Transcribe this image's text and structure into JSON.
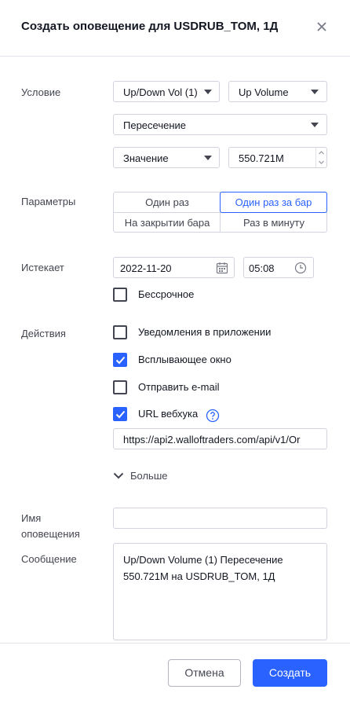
{
  "title": "Создать оповещение для USDRUB_TOM, 1Д",
  "condition": {
    "label": "Условие",
    "source": "Up/Down Vol (1)",
    "series": "Up Volume",
    "operator": "Пересечение",
    "target_type": "Значение",
    "value": "550.721M"
  },
  "parameters": {
    "label": "Параметры",
    "options": [
      "Один раз",
      "Один раз за бар",
      "На закрытии бара",
      "Раз в минуту"
    ],
    "selected": "Один раз за бар"
  },
  "expires": {
    "label": "Истекает",
    "date": "2022-11-20",
    "time": "05:08",
    "open_ended_label": "Бессрочное",
    "open_ended_checked": false
  },
  "actions": {
    "label": "Действия",
    "app_notifications": {
      "label": "Уведомления в приложении",
      "checked": false
    },
    "popup": {
      "label": "Всплывающее окно",
      "checked": true
    },
    "email": {
      "label": "Отправить e-mail",
      "checked": false
    },
    "webhook": {
      "label": "URL вебхука",
      "checked": true,
      "url": "https://api2.walloftraders.com/api/v1/Or"
    },
    "more_label": "Больше"
  },
  "alert_name": {
    "label_line1": "Имя",
    "label_line2": "оповещения",
    "value": ""
  },
  "message": {
    "label": "Сообщение",
    "value": "Up/Down Volume (1) Пересечение 550.721M на USDRUB_TOM, 1Д"
  },
  "footer": {
    "cancel_label": "Отмена",
    "create_label": "Создать"
  },
  "colors": {
    "accent": "#2962ff",
    "border": "#d1d4dc",
    "text": "#131722"
  }
}
